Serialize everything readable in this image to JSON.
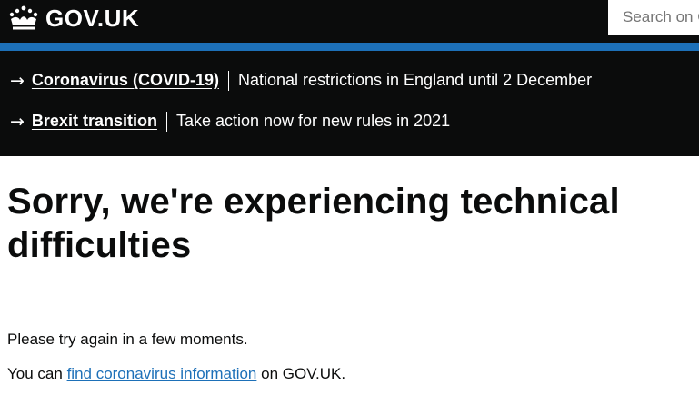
{
  "header": {
    "logo_text": "GOV.UK",
    "logo_icon": "crown-icon",
    "search_placeholder": "Search on GOV.UK"
  },
  "notices": [
    {
      "link": "Coronavirus (COVID-19)",
      "text": "National restrictions in England until 2 December"
    },
    {
      "link": "Brexit transition",
      "text": "Take action now for new rules in 2021"
    }
  ],
  "main": {
    "title": "Sorry, we're experiencing technical difficulties",
    "message": "Please try again in a few moments.",
    "info_prefix": "You can",
    "info_link": "find coronavirus information",
    "info_suffix": "on GOV.UK."
  },
  "colors": {
    "header_bg": "#0b0c0c",
    "accent_bar": "#1d70b8",
    "link": "#1d70b8",
    "text": "#0b0c0c"
  }
}
